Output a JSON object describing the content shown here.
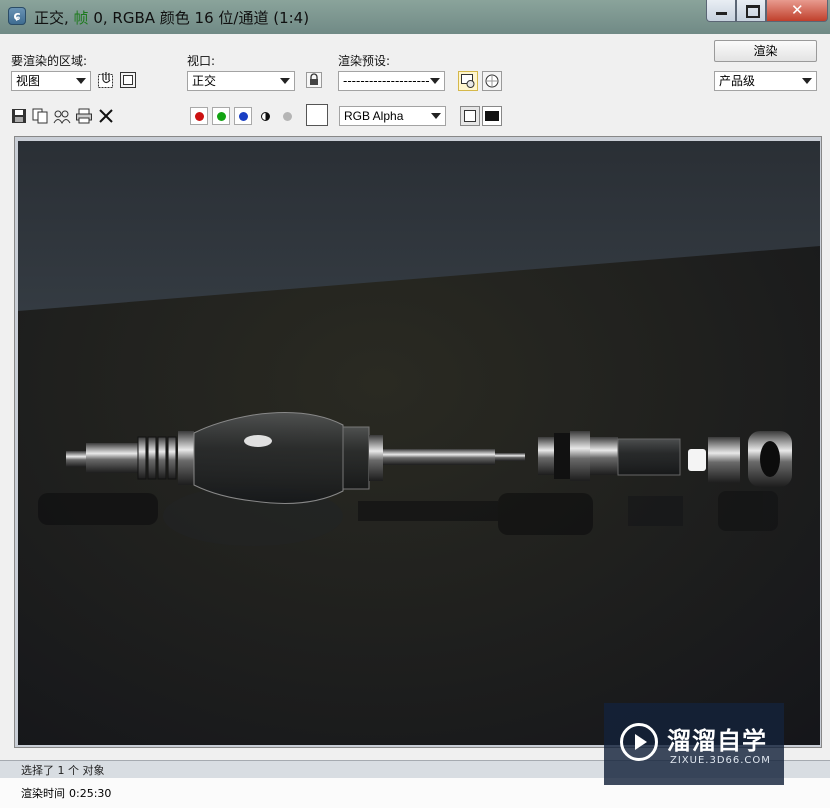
{
  "window": {
    "title_prefix": "正交, ",
    "title_frame_word": "帧",
    "title_suffix": " 0, RGBA 颜色 16 位/通道 (1:4)"
  },
  "toolbar": {
    "area_label": "要渲染的区域:",
    "area_value": "视图",
    "viewport_label": "视口:",
    "viewport_value": "正交",
    "preset_label": "渲染预设:",
    "preset_value": "--------------------",
    "render_button": "渲染",
    "quality_value": "产品级",
    "channel_value": "RGB Alpha"
  },
  "icons": {
    "save": "save-icon",
    "copy": "copy-icon",
    "clone": "clone-icon",
    "print": "print-icon",
    "clear": "clear-icon",
    "red": "#cc1111",
    "green": "#13a313",
    "blue": "#1a3fc4"
  },
  "status": {
    "selected_text": "选择了 1 个 对象",
    "render_time_label": "渲染时间",
    "render_time_value": "0:25:30"
  },
  "watermark": {
    "name": "溜溜自学",
    "url": "ZIXUE.3D66.COM"
  }
}
